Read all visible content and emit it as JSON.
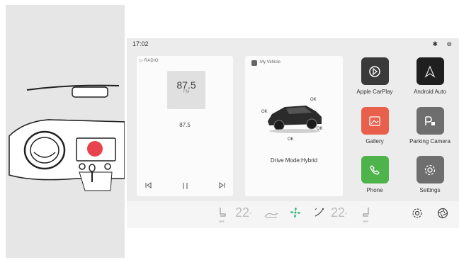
{
  "status": {
    "time": "17:02",
    "bluetooth_icon": "bluetooth-icon",
    "signal_icon": "signal-icon"
  },
  "radio": {
    "title": "▷ RADIO",
    "frequency": "87.5",
    "unit": "FM",
    "frequency_small": "87.5",
    "controls": {
      "prev": "⏮",
      "pause": "⏸",
      "next": "⏭"
    }
  },
  "vehicle": {
    "title": "My Vehicle",
    "status_labels": [
      "OK",
      "OK",
      "OK",
      "OK"
    ],
    "drive_mode": "Drive Mode:Hybrid"
  },
  "apps": [
    {
      "label": "Apple CarPlay",
      "icon": "carplay-icon",
      "color": "#3a3a3a"
    },
    {
      "label": "Android Auto",
      "icon": "android-auto-icon",
      "color": "#1f1f1f"
    },
    {
      "label": "Gallery",
      "icon": "gallery-icon",
      "color": "#e8604c"
    },
    {
      "label": "Parking Camera",
      "icon": "parking-camera-icon",
      "color": "#6e6e6e"
    },
    {
      "label": "Phone",
      "icon": "phone-icon",
      "color": "#4fb34c"
    },
    {
      "label": "Settings",
      "icon": "settings-icon",
      "color": "#6e6e6e"
    }
  ],
  "climate": {
    "left_seat": "OFF",
    "left_temp": "22",
    "left_temp_unit": "°",
    "right_temp": "22",
    "right_temp_unit": "°",
    "right_seat": "OFF",
    "fan_color": "#2eb36a"
  }
}
